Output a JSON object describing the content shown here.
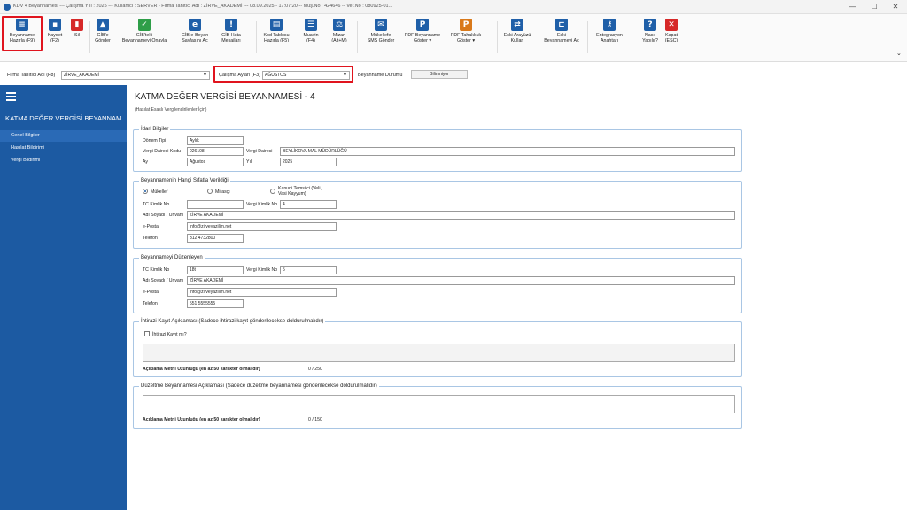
{
  "window": {
    "title": "KDV 4 Beyannamesi  ---  Çalışma Yılı : 2025  ---  Kullanıcı : SERVER - Firma Tanıtıcı Adı : ZİRVE_AKADEMİ  ---  08.09.2025 - 17:07:20  --  Müş.No : 424646  -- Ver.No : 080925-01.1",
    "min": "—",
    "max": "☐",
    "close": "✕"
  },
  "ribbon": {
    "buttons": [
      {
        "label": "Beyanname\nHazırla (F9)",
        "icon": "form-icon",
        "color": "#1f5fa8",
        "glyph": "≡"
      },
      {
        "label": "Kaydet\n(F2)",
        "icon": "save-icon",
        "color": "#1f5fa8",
        "glyph": "▪"
      },
      {
        "label": "Sil",
        "icon": "delete-icon",
        "color": "#d62828",
        "glyph": "▮"
      },
      {
        "label": "GİB'e\nGönder",
        "icon": "cloud-upload-icon",
        "color": "#1f5fa8",
        "glyph": "▲"
      },
      {
        "label": "GİB'teki\nBeyannameyi Onayla",
        "icon": "cloud-check-icon",
        "color": "#2e9e48",
        "glyph": "✓"
      },
      {
        "label": "GİB e-Beyan\nSayfasını Aç",
        "icon": "ie-browser-icon",
        "color": "#1f5fa8",
        "glyph": "e"
      },
      {
        "label": "GİB Hata\nMesajları",
        "icon": "warning-icon",
        "color": "#1f5fa8",
        "glyph": "!"
      },
      {
        "label": "Kod Tablosu\nHazırla (F5)",
        "icon": "table-code-icon",
        "color": "#1f5fa8",
        "glyph": "▤"
      },
      {
        "label": "Muavin\n(F4)",
        "icon": "list-icon",
        "color": "#1f5fa8",
        "glyph": "☰"
      },
      {
        "label": "Mizan\n(Alt+M)",
        "icon": "scale-icon",
        "color": "#1f5fa8",
        "glyph": "⚖"
      },
      {
        "label": "Mükellefe\nSMS Gönder",
        "icon": "sms-icon",
        "color": "#1f5fa8",
        "glyph": "✉"
      },
      {
        "label": "PDF Beyanname\nGöster ▾",
        "icon": "pdf-icon",
        "color": "#1f5fa8",
        "glyph": "P"
      },
      {
        "label": "PDF Tahakkuk\nGöster ▾",
        "icon": "pdf-orange-icon",
        "color": "#d9791a",
        "glyph": "P"
      },
      {
        "label": "Eski Arayüzü\nKullan",
        "icon": "switch-icon",
        "color": "#1f5fa8",
        "glyph": "⇄"
      },
      {
        "label": "Eski\nBeyannameyi Aç",
        "icon": "open-old-icon",
        "color": "#1f5fa8",
        "glyph": "⊏"
      },
      {
        "label": "Entegrasyon\nAnahtarı",
        "icon": "key-icon",
        "color": "#1f5fa8",
        "glyph": "⚷"
      },
      {
        "label": "Nasıl\nYapılır?",
        "icon": "help-icon",
        "color": "#1f5fa8",
        "glyph": "?"
      },
      {
        "label": "Kapat\n(ESC)",
        "icon": "close-red-icon",
        "color": "#d62828",
        "glyph": "✕"
      }
    ],
    "expand": "⌄"
  },
  "filter": {
    "firma_label": "Firma Tanıtıcı Adı (F8)",
    "firma_value": "ZİRVE_AKADEMİ",
    "calisma_label": "Çalışma Ayları (F3)",
    "calisma_value": "AĞUSTOS",
    "durum_label": "Beyanname Durumu",
    "durum_value": "Bilinmiyor"
  },
  "sidebar": {
    "title": "KATMA  DEĞER VERGİSİ BEYANNAM...",
    "items": [
      "Genel Bilgiler",
      "Hasılat Bildirimi",
      "Vergi Bildirimi"
    ]
  },
  "page": {
    "title": "KATMA  DEĞER VERGİSİ BEYANNAMESİ - 4",
    "subtitle": "(Hasılat Esaslı Vergilendirilenler İçin)"
  },
  "idari": {
    "title": "İdari Bilgiler",
    "donem_tipi_label": "Dönem Tipi",
    "donem_tipi": "Aylık",
    "vd_kodu_label": "Vergi Dairesi Kodu",
    "vd_kodu": "026108",
    "vd_label": "Vergi Dairesi",
    "vd": "BEYLİKOVA MAL MÜDÜRLÜĞÜ",
    "ay_label": "Ay",
    "ay": "Ağustos",
    "yil_label": "Yıl",
    "yil": "2025"
  },
  "sifat": {
    "title": "Beyannamenin Hangi Sıfatla Verildiği",
    "opt1": "Mükellef",
    "opt2": "Mirasçı",
    "opt3": "Kanuni Temsilci (Veli,\nVasi Kayyum)",
    "tc_label": "TC Kimlik No",
    "tc": "",
    "vkn_label": "Vergi Kimlik No",
    "vkn": "4",
    "ad_label": "Adı Soyadı / Unvanı",
    "ad": "ZİRVE AKADEMİ",
    "eposta_label": "e-Posta",
    "eposta": "info@zirveyazilim.net",
    "tel_label": "Telefon",
    "tel": "312 4732800"
  },
  "duzenleyen": {
    "title": "Beyannameyi Düzenleyen",
    "tc_label": "TC Kimlik No",
    "tc": "18t",
    "vkn_label": "Vergi Kimlik No",
    "vkn": "5",
    "ad_label": "Adı Soyadı / Unvanı",
    "ad": "ZİRVE AKADEMİ",
    "eposta_label": "e-Posta",
    "eposta": "info@zirveyazilim.net",
    "tel_label": "Telefon",
    "tel": "551 5555555"
  },
  "itiraz": {
    "title": "İhtirazi Kayıt Açıklaması (Sadece ihtirazi kayıt gönderilecekse doldurulmalıdır)",
    "chk_label": "İhtirazi Kayıt mı?",
    "len_label": "Açıklama Metni Uzunluğu (en az 50 karakter olmalıdır)",
    "len": "0 / 250"
  },
  "duzeltme": {
    "title": "Düzeltme Beyannamesi Açıklaması (Sadece düzeltme beyannamesi gönderilecekse doldurulmalıdır)",
    "len_label": "Açıklama Metni Uzunluğu (en az 50 karakter olmalıdır)",
    "len": "0 / 150"
  }
}
